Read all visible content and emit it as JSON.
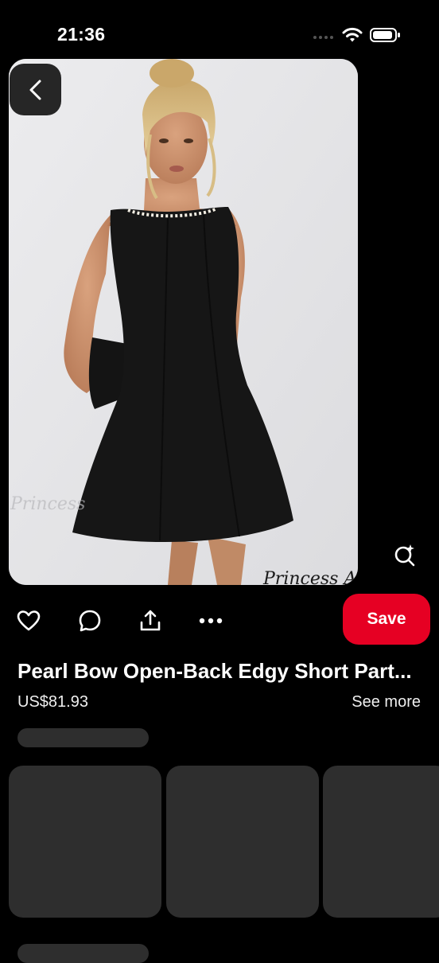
{
  "status_bar": {
    "time": "21:36"
  },
  "pin": {
    "image_description_icon": "dress-photo",
    "watermark_1": "Princess",
    "watermark_2": "Princess A",
    "title": "Pearl Bow Open-Back Edgy Short Part...",
    "price": "US$81.93",
    "see_more_label": "See more"
  },
  "actions": {
    "like_icon": "heart-icon",
    "comment_icon": "comment-icon",
    "share_icon": "share-icon",
    "more_icon": "more-icon",
    "save_label": "Save"
  },
  "colors": {
    "background": "#000000",
    "save_button": "#e60023",
    "skeleton": "#2e2e2e",
    "back_button": "#262626"
  }
}
